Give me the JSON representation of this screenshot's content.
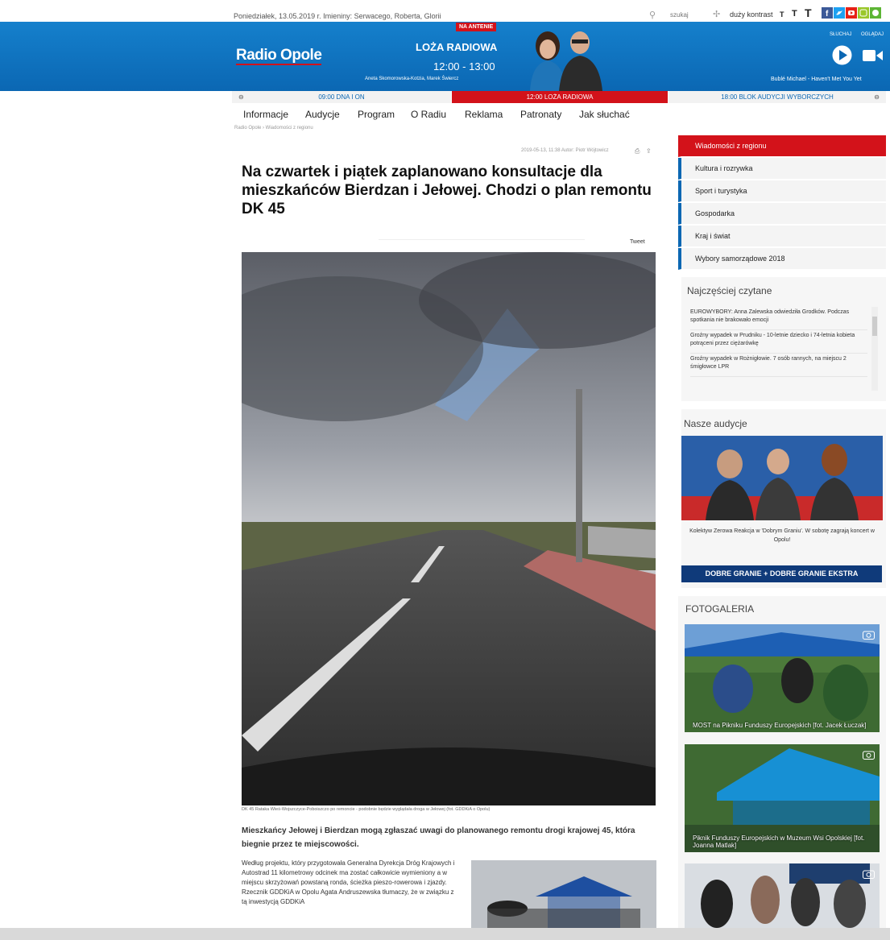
{
  "topbar": {
    "date": "Poniedziałek, 13.05.2019 r. Imieniny: Serwacego, Roberta, Glorii",
    "search_placeholder": "szukaj",
    "contrast_label": "duży kontrast",
    "text_size_labels": [
      "T",
      "T",
      "T"
    ],
    "social_icons": [
      "facebook-icon",
      "twitter-icon",
      "youtube-icon",
      "instagram-icon",
      "spotify-icon"
    ]
  },
  "header": {
    "logo": "Radio Opole",
    "on_air": "NA ANTENIE",
    "show_title": "LOŻA RADIOWA",
    "show_time": "12:00 - 13:00",
    "show_hosts": "Aneta Skomorowska-Kotzia, Marek Świercz",
    "listen_label": "SŁUCHAJ",
    "watch_label": "OGLĄDAJ",
    "now_playing": "Bublé Michael - Haven't Met You Yet"
  },
  "schedule": {
    "prev": "⊖",
    "items": [
      "09:00 DNA I ON",
      "12:00 LOŻA RADIOWA",
      "18:00 BLOK AUDYCJI WYBORCZYCH"
    ],
    "next": "⊖"
  },
  "menu": [
    "Informacje",
    "Audycje",
    "Program",
    "O Radiu",
    "Reklama",
    "Patronaty",
    "Jak słuchać"
  ],
  "breadcrumb": "Radio Opole  ›  Wiadomości z regionu",
  "article": {
    "meta": "2019-05-13, 11:38   Autor: Piotr Wójtowicz",
    "title": "Na czwartek i piątek zaplanowano konsultacje dla mieszkańców Bierdzan i Jełowej. Chodzi o plan remontu DK 45",
    "tweet": "Tweet",
    "caption": "DK 45 Rataka Wieś-Wojszczyce-Poboiszczo po remoncie - podobnie będzie wyglądała droga w Jełowej (fot. GDDKiA o Opolu)",
    "lead": "Mieszkańcy Jełowej i Bierdzan mogą zgłaszać uwagi do planowanego remontu drogi krajowej 45, która biegnie przez te miejscowości.",
    "body": "Według projektu, który przygotowała Generalna Dyrekcja Dróg Krajowych i Autostrad 11 kilometrowy odcinek ma zostać całkowicie wymieniony a w miejscu skrzyżowań powstaną ronda, ścieżka pieszo-rowerowa i zjazdy. Rzecznik GDDKiA w Opolu Agata Andruszewska tłumaczy, że w związku z tą inwestycją GDDKiA"
  },
  "sidebar": {
    "categories": [
      "Wiadomości z regionu",
      "Kultura i rozrywka",
      "Sport i turystyka",
      "Gospodarka",
      "Kraj i świat",
      "Wybory samorządowe 2018"
    ],
    "popular_title": "Najczęściej czytane",
    "popular": [
      "EUROWYBORY: Anna Zalewska odwiedziła Grodków. Podczas spotkania nie brakowało emocji",
      "Groźny wypadek w Prudniku - 10-letnie dziecko i 74-letnia kobieta potrąceni przez ciężarówkę",
      "Groźny wypadek w Rożnigłowie. 7 osób rannych, na miejscu 2 śmigłowce LPR"
    ],
    "audycje_title": "Nasze audycje",
    "audycje_caption": "Kolektyw Zerowa Reakcja w 'Dobrym Graniu'. W sobotę zagrają koncert w Opolu!",
    "audycje_button": "DOBRE GRANIE + DOBRE GRANIE EKSTRA",
    "gallery_title": "FOTOGALERIA",
    "gallery": [
      "MOST na Pikniku Funduszy Europejskich [fot. Jacek Łuczak]",
      "Piknik Funduszy Europejskich w Muzeum Wsi Opolskiej [fot. Joanna Matlak]",
      ""
    ]
  },
  "colors": {
    "brand_blue": "#0b67b3",
    "brand_red": "#d3121a",
    "navy": "#0f3a7a"
  }
}
